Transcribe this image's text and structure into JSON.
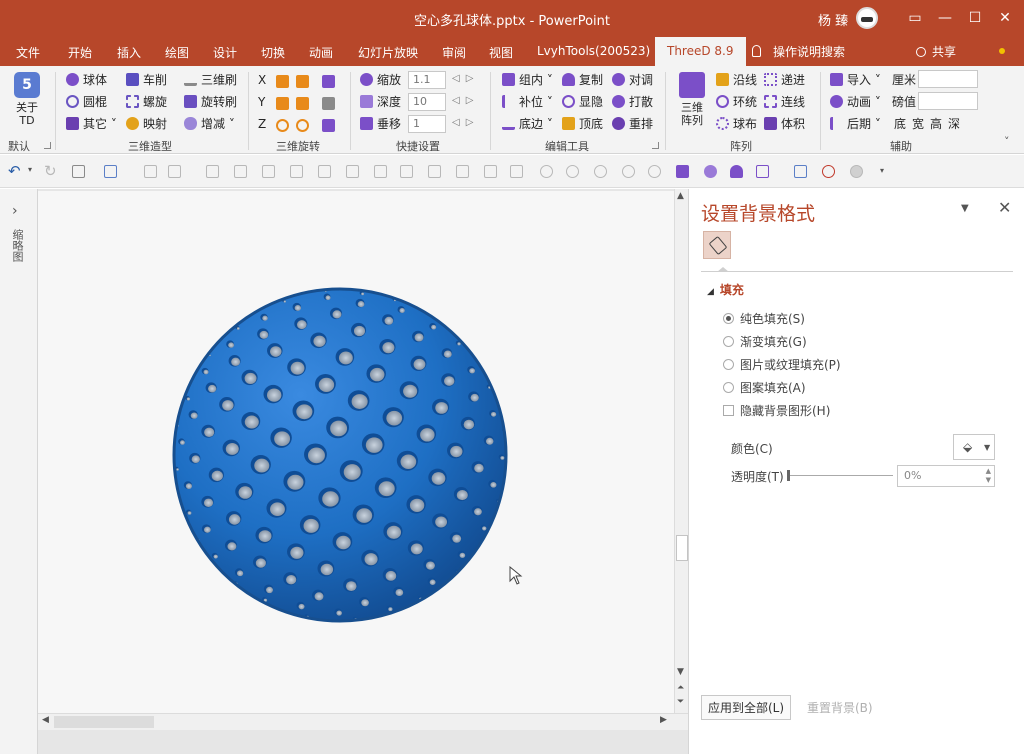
{
  "window": {
    "title": "空心多孔球体.pptx  -  PowerPoint",
    "user": "杨 臻",
    "controls": [
      "—",
      "☐",
      "✕"
    ]
  },
  "tabs": [
    "文件",
    "开始",
    "插入",
    "绘图",
    "设计",
    "切换",
    "动画",
    "幻灯片放映",
    "审阅",
    "视图",
    "LvyhTools(200523)",
    "ThreeD 8.9"
  ],
  "tell_me": "操作说明搜索",
  "share": "共享",
  "ribbon": {
    "about": "关于\nTD",
    "groups": {
      "default": "默认",
      "modeling": "三维造型",
      "rotation": "三维旋转",
      "quick": "快捷设置",
      "edit": "编辑工具",
      "array": "阵列",
      "aux": "辅助"
    },
    "modeling": {
      "col1": [
        "球体",
        "圆棍",
        "其它"
      ],
      "col2": [
        "车削",
        "螺旋",
        "映射"
      ],
      "col3": [
        "三维刷",
        "旋转刷",
        "增减"
      ]
    },
    "rotation_axes": [
      "X",
      "Y",
      "Z"
    ],
    "quick": {
      "labels": [
        "缩放",
        "深度",
        "垂移"
      ],
      "values": [
        "1.1",
        "10",
        "1"
      ]
    },
    "edit": {
      "col1": [
        "组内",
        "补位",
        "底边"
      ],
      "col2": [
        "复制",
        "显隐",
        "顶底"
      ],
      "col3": [
        "对调",
        "打散",
        "重排"
      ]
    },
    "array": {
      "big": "三维\n阵列",
      "col1": [
        "沿线",
        "环统",
        "球布"
      ],
      "col2": [
        "递进",
        "连线",
        "体积"
      ]
    },
    "aux": {
      "col1": [
        "导入",
        "动画",
        "后期"
      ],
      "units": [
        "厘米",
        "磅值"
      ],
      "letters": [
        "底",
        "宽",
        "高",
        "深"
      ]
    }
  },
  "left_nav": {
    "label": "缩略图"
  },
  "format_pane": {
    "title": "设置背景格式",
    "section": "填充",
    "options": [
      {
        "label": "纯色填充(S)",
        "selected": true
      },
      {
        "label": "渐变填充(G)",
        "selected": false
      },
      {
        "label": "图片或纹理填充(P)",
        "selected": false
      },
      {
        "label": "图案填充(A)",
        "selected": false
      }
    ],
    "hide_bg": "隐藏背景图形(H)",
    "color_label": "颜色(C)",
    "transparency_label": "透明度(T)",
    "transparency_value": "0%",
    "transparency": 0,
    "apply_all": "应用到全部(L)",
    "reset": "重置背景(B)"
  },
  "colors": {
    "accent": "#b7472a",
    "sphere": "#1e6fc4",
    "ribbon_bg": "#f3f3f3"
  }
}
